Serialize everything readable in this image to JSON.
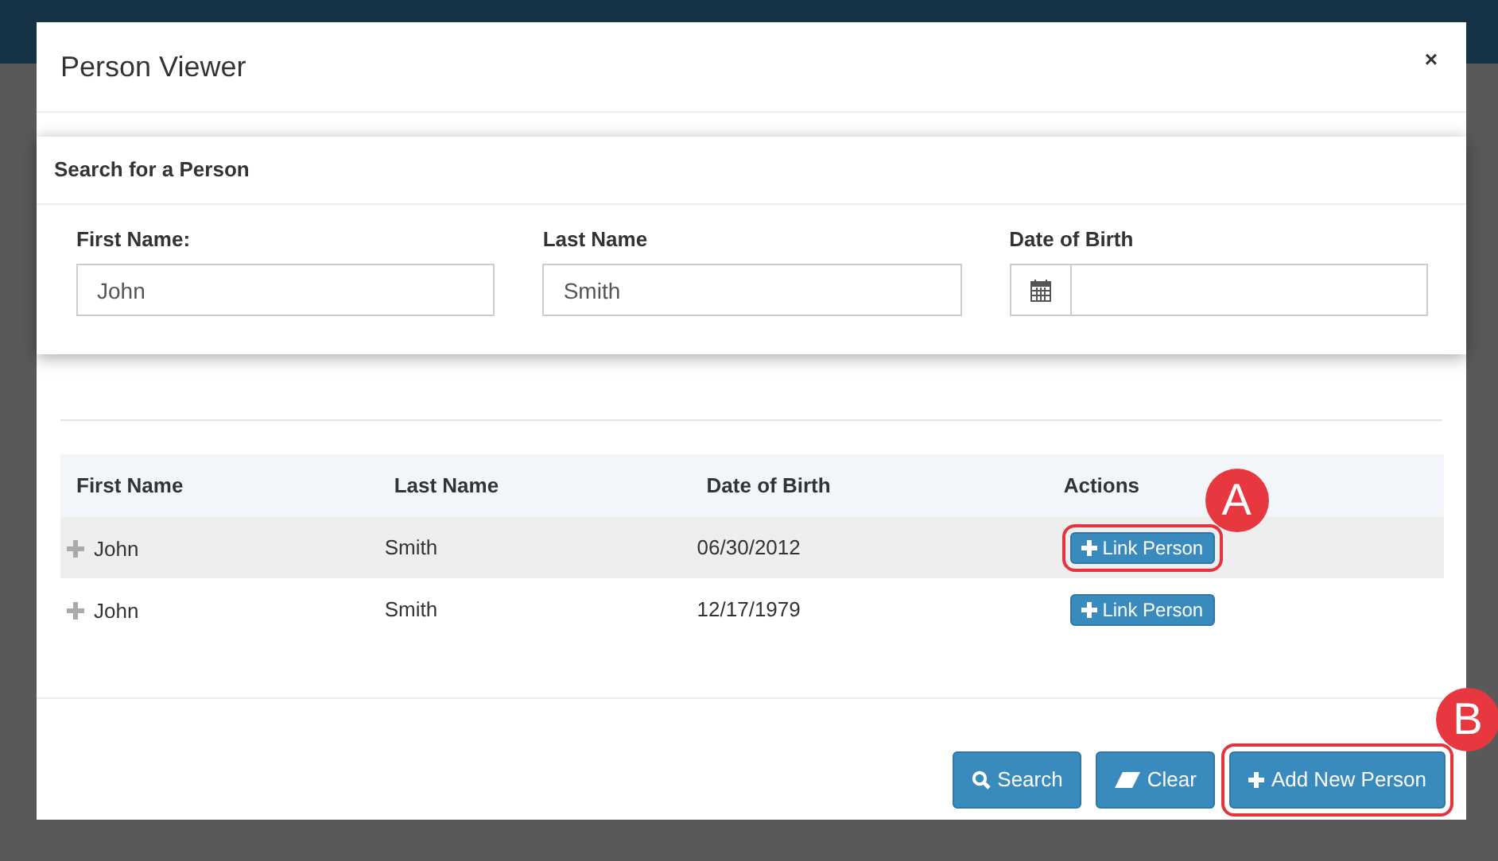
{
  "modal": {
    "title": "Person Viewer",
    "close": "×"
  },
  "search_panel": {
    "title": "Search for a Person",
    "fields": [
      {
        "label": "First Name:",
        "value": "John",
        "kind": "text"
      },
      {
        "label": "Last Name",
        "value": "Smith",
        "kind": "text"
      },
      {
        "label": "Date of Birth",
        "kind": "date"
      }
    ]
  },
  "table": {
    "columns": [
      "First Name",
      "Last Name",
      "Date of Birth",
      "Actions"
    ],
    "rows": [
      {
        "first_name": "John",
        "last_name": "Smith",
        "date_of_birth": "06/30/2012",
        "action": "Link Person",
        "selected": true
      },
      {
        "first_name": "John",
        "last_name": "Smith",
        "date_of_birth": "12/17/1979",
        "action": "Link Person",
        "selected": false
      }
    ]
  },
  "buttons": [
    {
      "label": "Search",
      "kind": "search"
    },
    {
      "label": "Clear",
      "kind": "clear"
    },
    {
      "label": "Add New Person",
      "kind": "add"
    }
  ],
  "callouts": [
    {
      "letter": "A"
    },
    {
      "letter": "B"
    }
  ]
}
